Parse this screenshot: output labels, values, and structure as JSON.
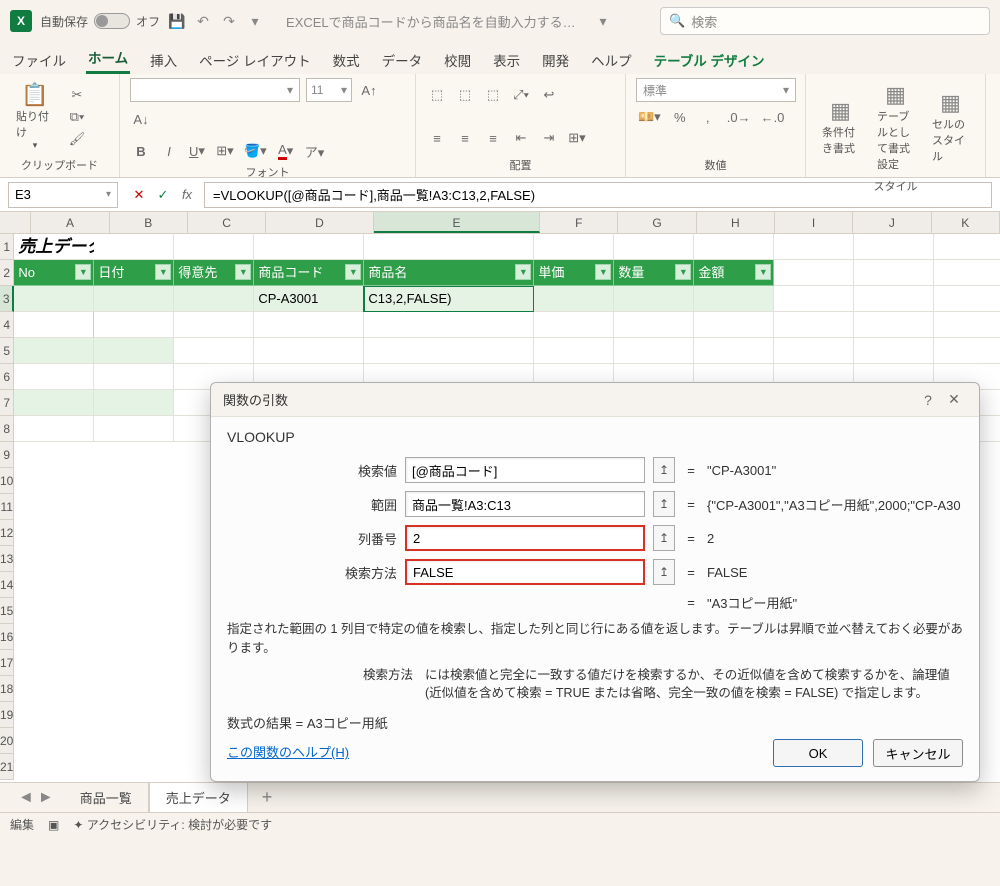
{
  "titlebar": {
    "autosave_label": "自動保存",
    "autosave_state": "オフ",
    "doc_title": "EXCELで商品コードから商品名を自動入力する方…",
    "search_placeholder": "検索"
  },
  "tabs": {
    "file": "ファイル",
    "home": "ホーム",
    "insert": "挿入",
    "page_layout": "ページ レイアウト",
    "formulas": "数式",
    "data": "データ",
    "review": "校閲",
    "view": "表示",
    "developer": "開発",
    "help": "ヘルプ",
    "table_design": "テーブル デザイン"
  },
  "ribbon": {
    "clipboard": {
      "label": "クリップボード",
      "paste": "貼り付け"
    },
    "font": {
      "label": "フォント",
      "size": "11"
    },
    "align": {
      "label": "配置"
    },
    "number": {
      "label": "数値",
      "format": "標準"
    },
    "styles": {
      "label": "スタイル",
      "cond": "条件付き書式",
      "table": "テーブルとして書式設定",
      "cell": "セルのスタイル"
    }
  },
  "formula_bar": {
    "name_box": "E3",
    "formula": "=VLOOKUP([@商品コード],商品一覧!A3:C13,2,FALSE)"
  },
  "columns": [
    "A",
    "B",
    "C",
    "D",
    "E",
    "F",
    "G",
    "H",
    "I",
    "J",
    "K"
  ],
  "rows": [
    "1",
    "2",
    "3",
    "4",
    "5",
    "6",
    "7",
    "8",
    "9",
    "10",
    "11",
    "12",
    "13",
    "14",
    "15",
    "16",
    "17",
    "18",
    "19",
    "20",
    "21"
  ],
  "sheet": {
    "title": "売上データ",
    "headers": {
      "no": "No",
      "date": "日付",
      "customer": "得意先",
      "code": "商品コード",
      "name": "商品名",
      "price": "単価",
      "qty": "数量",
      "amount": "金額"
    },
    "row3": {
      "code": "CP-A3001",
      "name": "C13,2,FALSE)"
    }
  },
  "dialog": {
    "title": "関数の引数",
    "fn": "VLOOKUP",
    "args": {
      "lookup_value": {
        "label": "検索値",
        "value": "[@商品コード]",
        "result": "\"CP-A3001\""
      },
      "table_array": {
        "label": "範囲",
        "value": "商品一覧!A3:C13",
        "result": "{\"CP-A3001\",\"A3コピー用紙\",2000;\"CP-A30"
      },
      "col_index": {
        "label": "列番号",
        "value": "2",
        "result": "2"
      },
      "range_lookup": {
        "label": "検索方法",
        "value": "FALSE",
        "result": "FALSE"
      }
    },
    "preview_eq": "=",
    "preview_result": "\"A3コピー用紙\"",
    "description": "指定された範囲の 1 列目で特定の値を検索し、指定した列と同じ行にある値を返します。テーブルは昇順で並べ替えておく必要があります。",
    "arg_name": "検索方法",
    "arg_desc": "には検索値と完全に一致する値だけを検索するか、その近似値を含めて検索するかを、論理値 (近似値を含めて検索 = TRUE または省略、完全一致の値を検索 = FALSE) で指定します。",
    "result_label": "数式の結果 = ",
    "result_value": "A3コピー用紙",
    "help_link": "この関数のヘルプ(H)",
    "ok": "OK",
    "cancel": "キャンセル"
  },
  "sheet_tabs": {
    "sheet1": "商品一覧",
    "sheet2": "売上データ"
  },
  "statusbar": {
    "mode": "編集",
    "a11y": "アクセシビリティ: 検討が必要です"
  }
}
